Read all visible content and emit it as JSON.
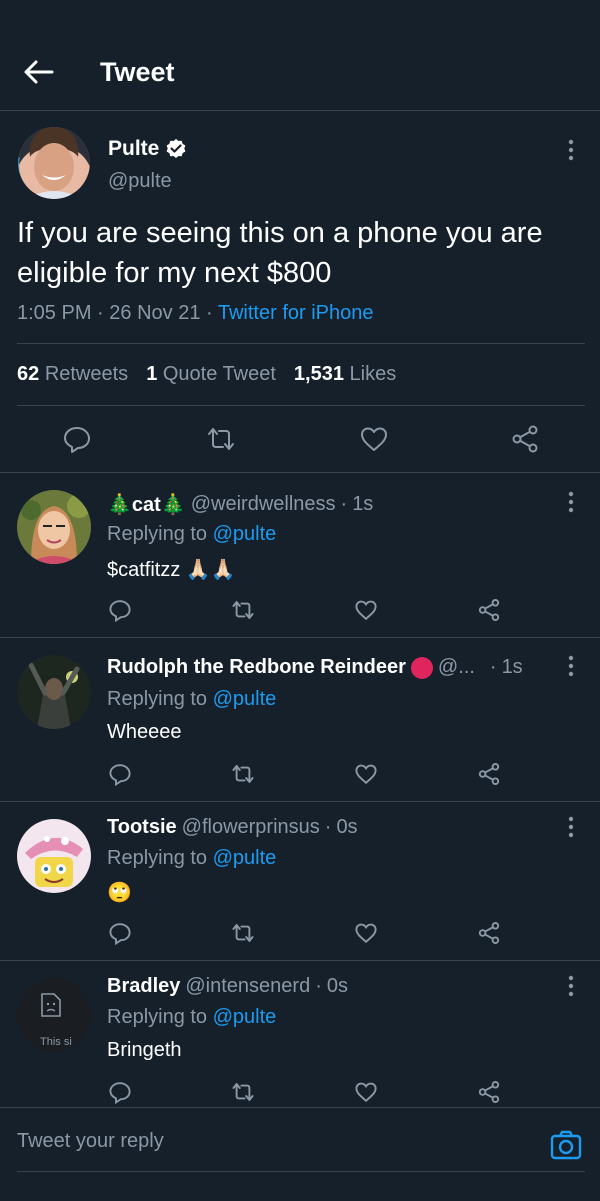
{
  "header": {
    "title": "Tweet"
  },
  "main_tweet": {
    "name": "Pulte",
    "handle": "@pulte",
    "text": "If you are seeing this on a phone you are eligible for my next $800",
    "time": "1:05 PM",
    "date": "26 Nov 21",
    "source": "Twitter for iPhone",
    "retweets_count": "62",
    "retweets_label": "Retweets",
    "quotes_count": "1",
    "quotes_label": "Quote Tweet",
    "likes_count": "1,531",
    "likes_label": "Likes"
  },
  "replies": [
    {
      "name": "🎄cat🎄",
      "handle": "@weirdwellness",
      "time": "1s",
      "replying_prefix": "Replying to",
      "replying_to": "@pulte",
      "text": "$catfitzz 🙏🏻🙏🏻"
    },
    {
      "name": "Rudolph the Redbone Reindeer",
      "handle": "@...",
      "time": "1s",
      "replying_prefix": "Replying to",
      "replying_to": "@pulte",
      "text": "Wheeee"
    },
    {
      "name": "Tootsie",
      "handle": "@flowerprinsus",
      "time": "0s",
      "replying_prefix": "Replying to",
      "replying_to": "@pulte",
      "text": "🙄"
    },
    {
      "name": "Bradley",
      "handle": "@intensenerd",
      "time": "0s",
      "replying_prefix": "Replying to",
      "replying_to": "@pulte",
      "text": "Bringeth",
      "avatar_alt": "This si"
    }
  ],
  "composer": {
    "placeholder": "Tweet your reply"
  },
  "colors": {
    "background": "#15202b",
    "muted": "#8b98a5",
    "link": "#1d9bf0",
    "divider": "#38444d",
    "verified": "#ffffff",
    "red_dot": "#e0245e"
  },
  "icons": [
    "back-arrow-icon",
    "verified-badge-icon",
    "more-icon",
    "reply-icon",
    "retweet-icon",
    "like-icon",
    "share-icon",
    "camera-icon",
    "broken-image-icon"
  ]
}
